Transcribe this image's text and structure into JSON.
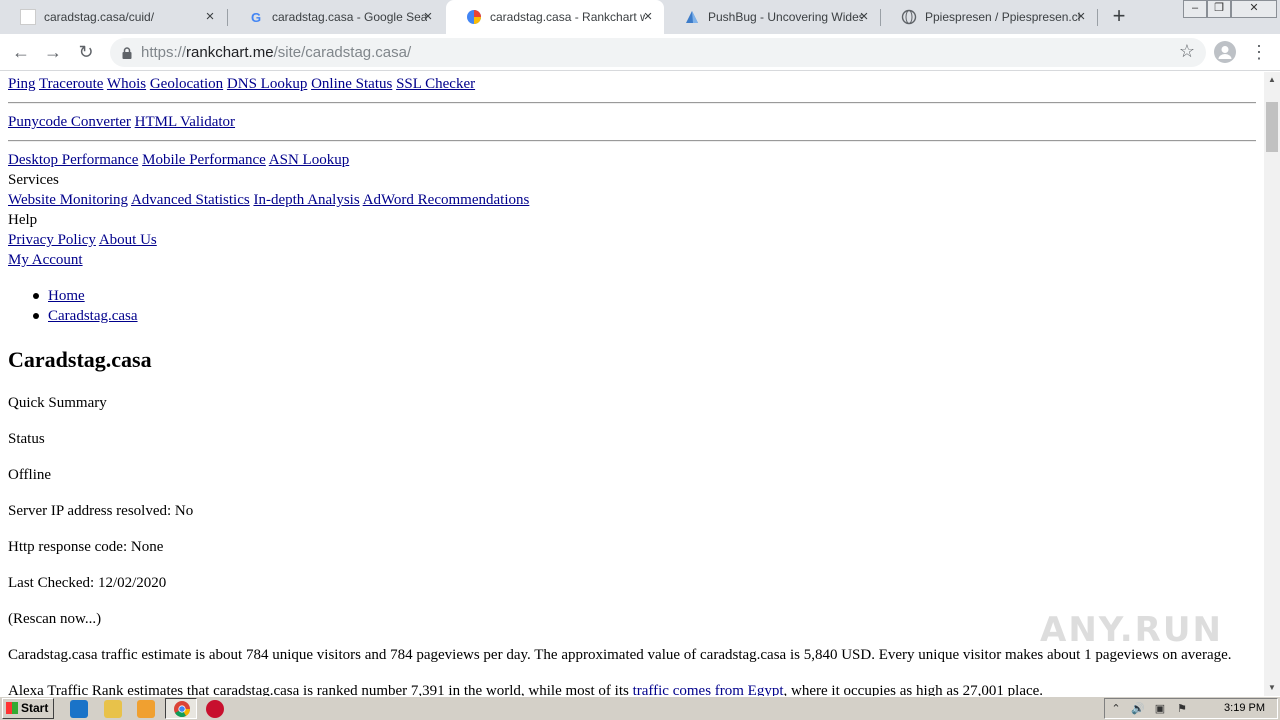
{
  "browser": {
    "tabs": [
      {
        "title": "caradstag.casa/cuid/",
        "active": false
      },
      {
        "title": "caradstag.casa - Google Search",
        "active": false
      },
      {
        "title": "caradstag.casa - Rankchart website",
        "active": true
      },
      {
        "title": "PushBug - Uncovering Widespread",
        "active": false
      },
      {
        "title": "Ppiespresen / Ppiespresen.club",
        "active": false
      }
    ],
    "url": {
      "scheme": "https://",
      "host": "rankchart.me",
      "path": "/site/caradstag.casa/"
    }
  },
  "page": {
    "nav_row1": [
      "Ping",
      "Traceroute",
      "Whois",
      "Geolocation",
      "DNS Lookup",
      "Online Status",
      "SSL Checker"
    ],
    "nav_row2": [
      "Punycode Converter",
      "HTML Validator"
    ],
    "nav_row3": [
      "Desktop Performance",
      "Mobile Performance",
      "ASN Lookup"
    ],
    "services_label": "Services",
    "services_links": [
      "Website Monitoring",
      "Advanced Statistics",
      "In-depth Analysis",
      "AdWord Recommendations"
    ],
    "help_label": "Help",
    "help_links": [
      "Privacy Policy",
      "About Us"
    ],
    "account_link": "My Account",
    "breadcrumb": [
      "Home",
      "Caradstag.casa"
    ],
    "heading": "Caradstag.casa",
    "quick_summary": "Quick Summary",
    "status_label": "Status",
    "status_value": "Offline",
    "server_ip": "Server IP address resolved: No",
    "http_code": "Http response code: None",
    "last_checked": "Last Checked: 12/02/2020",
    "rescan": "(Rescan now...)",
    "traffic_text": "Caradstag.casa traffic estimate is about 784 unique visitors and 784 pageviews per day. The approximated value of caradstag.casa is 5,840 USD. Every unique visitor makes about 1 pageviews on average.",
    "alexa_prefix": "Alexa Traffic Rank estimates that caradstag.casa is ranked number 7,391 in the world, while most of its ",
    "alexa_link": "traffic comes from Egypt",
    "alexa_suffix": ", where it occupies as high as 27,001 place."
  },
  "watermark": "ANY.RUN",
  "taskbar": {
    "start_label": "Start",
    "clock": "3:19 PM"
  }
}
